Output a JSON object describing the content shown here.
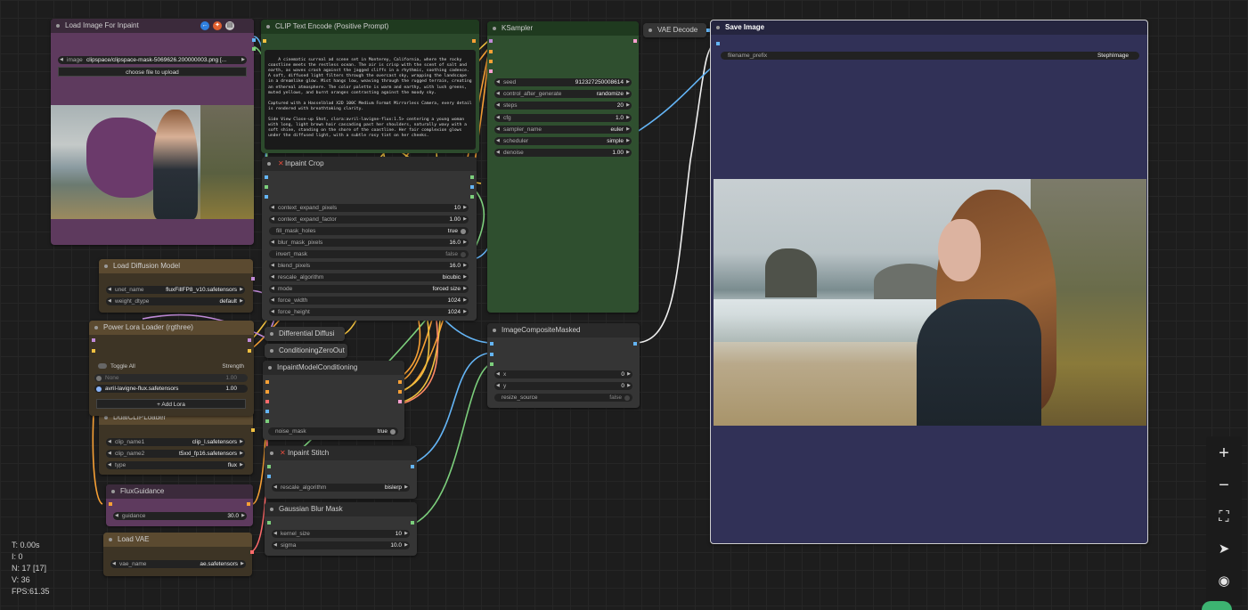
{
  "colors": {
    "canvas_bg": "#1d1d1d",
    "node_default": "#353535",
    "node_title_default": "#222222",
    "node_purple": "#5e3a5e",
    "node_purple_title": "#3b2a3b",
    "node_brown": "#3d3425",
    "node_brown_title": "#5b4a30",
    "node_green": "#2b4a2b",
    "node_green_title": "#1f3a1f",
    "node_navy": "#313157",
    "wire_yellow": "#f0c040",
    "wire_orange": "#f7a035",
    "wire_purple": "#c08ad8",
    "wire_blue": "#64b5f6",
    "wire_green": "#7ccf7c",
    "wire_white": "#f0f0f0"
  },
  "nodes": {
    "load_image": {
      "title": "Load Image For Inpaint",
      "image_label": "image",
      "image_value": "clipspace/clipspace-mask-5069626.200000003.png [...",
      "upload_button": "choose file to upload",
      "badge_icons": [
        "arrow-left-icon",
        "fire-icon",
        "document-icon"
      ]
    },
    "clip_pos": {
      "title": "CLIP Text Encode (Positive Prompt)",
      "text": "A cinematic surreal ad scene set in Monterey, California, where the rocky coastline meets the restless ocean. The air is crisp with the scent of salt and earth, as waves crash against the jagged cliffs in a rhythmic, soothing cadence. A soft, diffused light filters through the overcast sky, wrapping the landscape in a dreamlike glow. Mist hangs low, weaving through the rugged terrain, creating an ethereal atmosphere. The color palette is warm and earthy, with lush greens, muted yellows, and burnt oranges contrasting against the moody sky.\n\nCaptured with a Hasselblad X2D 100C Medium Format Mirrorless Camera, every detail is rendered with breathtaking clarity.\n\nSide View Close-up Shot, clora:avril-lavigne-flux:1.5> centering a young woman with long, light brown hair cascading past her shoulders, naturally wavy with a soft shine, standing on the shore of the coastline. Her fair complexion glows under the diffused light, with a subtle rosy tint on her cheeks."
    },
    "ksampler": {
      "title": "KSampler",
      "widgets": [
        {
          "label": "seed",
          "value": "912327250008614"
        },
        {
          "label": "control_after_generate",
          "value": "randomize"
        },
        {
          "label": "steps",
          "value": "20"
        },
        {
          "label": "cfg",
          "value": "1.0"
        },
        {
          "label": "sampler_name",
          "value": "euler"
        },
        {
          "label": "scheduler",
          "value": "simple"
        },
        {
          "label": "denoise",
          "value": "1.00"
        }
      ]
    },
    "vae_decode": {
      "title": "VAE Decode"
    },
    "save_image": {
      "title": "Save Image",
      "filename_label": "filename_prefix",
      "filename_value": "StephImage"
    },
    "inpaint_crop": {
      "title": "Inpaint Crop",
      "widgets": [
        {
          "label": "context_expand_pixels",
          "value": "10",
          "kind": "num"
        },
        {
          "label": "context_expand_factor",
          "value": "1.00",
          "kind": "num"
        },
        {
          "label": "fill_mask_holes",
          "value": "true",
          "kind": "toggle"
        },
        {
          "label": "blur_mask_pixels",
          "value": "16.0",
          "kind": "num"
        },
        {
          "label": "invert_mask",
          "value": "false",
          "kind": "toggle"
        },
        {
          "label": "blend_pixels",
          "value": "16.0",
          "kind": "num"
        },
        {
          "label": "rescale_algorithm",
          "value": "bicubic",
          "kind": "num"
        },
        {
          "label": "mode",
          "value": "forced size",
          "kind": "num"
        },
        {
          "label": "force_width",
          "value": "1024",
          "kind": "num"
        },
        {
          "label": "force_height",
          "value": "1024",
          "kind": "num"
        }
      ]
    },
    "load_diffusion": {
      "title": "Load Diffusion Model",
      "widgets": [
        {
          "label": "unet_name",
          "value": "fluxFillFP8_v10.safetensors"
        },
        {
          "label": "weight_dtype",
          "value": "default"
        }
      ]
    },
    "power_lora": {
      "title": "Power Lora Loader (rgthree)",
      "toggle_all": "Toggle All",
      "strength": "Strength",
      "lora1_name": "None",
      "lora1_value": "1.00",
      "lora2_name": "avril-lavigne-flux.safetensors",
      "lora2_value": "1.00",
      "add_lora": "Add Lora"
    },
    "dual_clip": {
      "title": "DualCLIPLoader",
      "widgets": [
        {
          "label": "clip_name1",
          "value": "clip_l.safetensors"
        },
        {
          "label": "clip_name2",
          "value": "t5xxl_fp16.safetensors"
        },
        {
          "label": "type",
          "value": "flux"
        }
      ]
    },
    "flux_guidance": {
      "title": "FluxGuidance",
      "widgets": [
        {
          "label": "guidance",
          "value": "30.0"
        }
      ]
    },
    "load_vae": {
      "title": "Load VAE",
      "widgets": [
        {
          "label": "vae_name",
          "value": "ae.safetensors"
        }
      ]
    },
    "differential": {
      "title": "Differential Diffusi"
    },
    "cond_zero": {
      "title": "ConditioningZeroOut"
    },
    "inpaint_model_cond": {
      "title": "InpaintModelConditioning",
      "noise_mask_label": "noise_mask",
      "noise_mask_value": "true"
    },
    "inpaint_stitch": {
      "title": "Inpaint Stitch",
      "widgets": [
        {
          "label": "rescale_algorithm",
          "value": "bislerp"
        }
      ]
    },
    "gaussian_blur": {
      "title": "Gaussian Blur Mask",
      "widgets": [
        {
          "label": "kernel_size",
          "value": "10"
        },
        {
          "label": "sigma",
          "value": "10.0"
        }
      ]
    },
    "image_composite": {
      "title": "ImageCompositeMasked",
      "widgets": [
        {
          "label": "x",
          "value": "0"
        },
        {
          "label": "y",
          "value": "0"
        },
        {
          "label": "resize_source",
          "value": "false"
        }
      ]
    }
  },
  "sidebar": {
    "items": [
      {
        "icon": "zoom-in-icon",
        "glyph": "+"
      },
      {
        "icon": "zoom-out-icon",
        "glyph": "−"
      },
      {
        "icon": "fit-view-icon",
        "glyph": "⛶"
      },
      {
        "icon": "select-tool-icon",
        "glyph": "➤"
      },
      {
        "icon": "eye-icon",
        "glyph": "◉"
      }
    ]
  },
  "stats": {
    "t": "T: 0.00s",
    "i": "I: 0",
    "n": "N: 17 [17]",
    "v": "V: 36",
    "fps": "FPS:61.35"
  }
}
